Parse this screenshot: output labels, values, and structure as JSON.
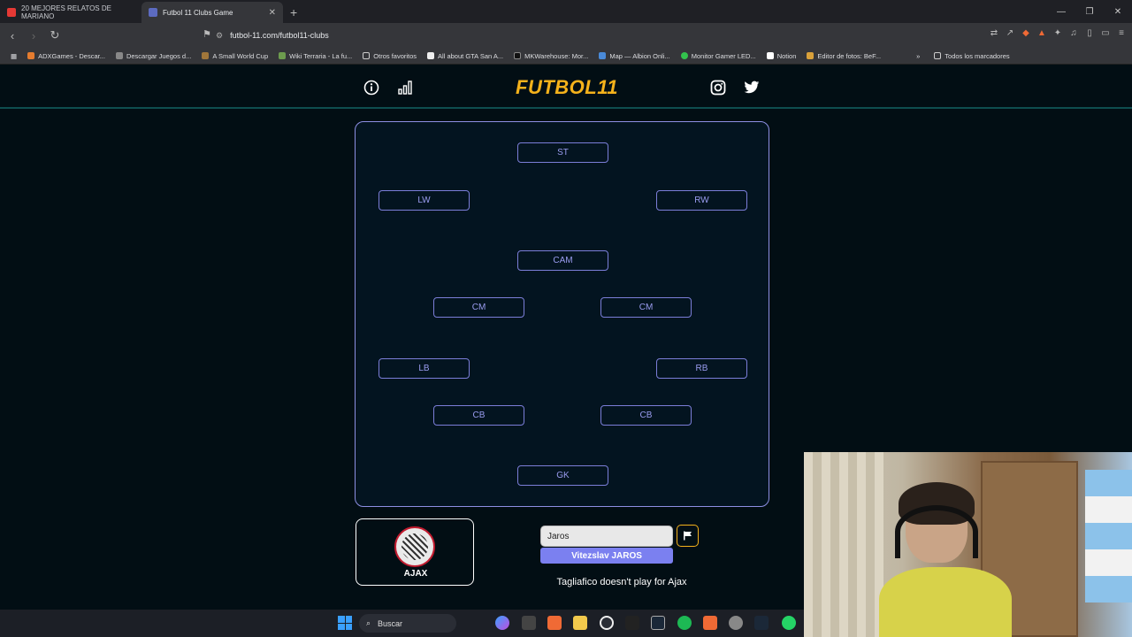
{
  "browser": {
    "tabs": [
      {
        "title": "20 MEJORES RELATOS DE MARIANO",
        "active": false,
        "favicon_color": "#e53935"
      },
      {
        "title": "Futbol 11 Clubs Game",
        "active": true,
        "favicon_color": "#5c6bc0"
      }
    ],
    "new_tab": "+",
    "window_controls": [
      "—",
      "❐",
      "✕"
    ],
    "url": "futbol-11.com/futbol11-clubs",
    "bookmarks": [
      "ADXGames - Descar...",
      "Descargar Juegos d...",
      "A Small World Cup",
      "Wiki Terraria - La fu...",
      "Otros favoritos",
      "All about GTA San A...",
      "MKWarehouse: Mor...",
      "Map — Albion Onli...",
      "Monitor Gamer LED...",
      "Notion",
      "Editor de fotos: BeF...",
      "Todos los marcadores"
    ]
  },
  "site": {
    "logo": "FUTBOL11",
    "header_icons": [
      "info-icon",
      "stats-icon",
      "instagram-icon",
      "twitter-icon"
    ],
    "colors": {
      "accent": "#f5b21b",
      "pitch_border": "#8d8fe3",
      "suggestion": "#7b80f0"
    }
  },
  "pitch": {
    "positions": [
      {
        "id": "st",
        "label": "ST"
      },
      {
        "id": "lw",
        "label": "LW"
      },
      {
        "id": "rw",
        "label": "RW"
      },
      {
        "id": "cam",
        "label": "CAM"
      },
      {
        "id": "cm-left",
        "label": "CM"
      },
      {
        "id": "cm-right",
        "label": "CM"
      },
      {
        "id": "lb",
        "label": "LB"
      },
      {
        "id": "rb",
        "label": "RB"
      },
      {
        "id": "cb-left",
        "label": "CB"
      },
      {
        "id": "cb-right",
        "label": "CB"
      },
      {
        "id": "gk",
        "label": "GK"
      }
    ]
  },
  "club": {
    "name": "AJAX"
  },
  "search": {
    "value": "Jaros",
    "placeholder": ""
  },
  "suggestion": {
    "player": "Vitezslav JAROS"
  },
  "message": "Tagliafico doesn't play for Ajax",
  "taskbar": {
    "search_label": "Buscar"
  }
}
